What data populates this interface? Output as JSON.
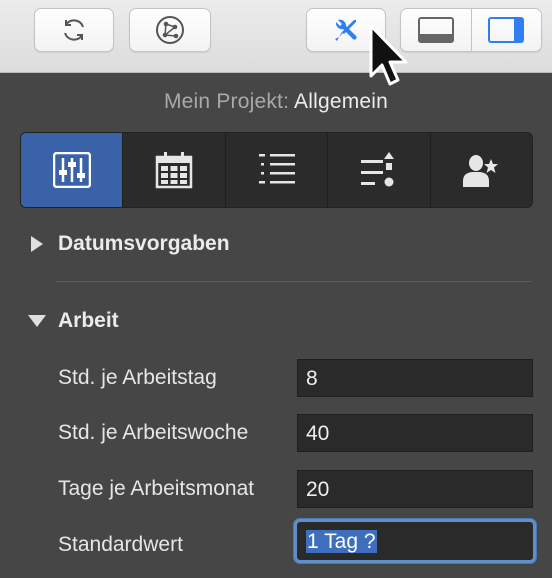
{
  "toolbar": {
    "buttons": [
      {
        "icon": "refresh-icon",
        "interactable": true
      },
      {
        "icon": "network-icon",
        "interactable": true
      },
      {
        "icon": "tools-icon",
        "interactable": true
      }
    ],
    "view_toggle": [
      {
        "icon": "bottom-panel-icon"
      },
      {
        "icon": "right-sidebar-icon"
      }
    ],
    "accent_color": "#2f7ff2"
  },
  "breadcrumb": {
    "label": "Mein Projekt:",
    "value": "Allgemein"
  },
  "tabs": [
    {
      "icon": "sliders-icon",
      "active": true
    },
    {
      "icon": "calendar-icon",
      "active": false
    },
    {
      "icon": "list-icon",
      "active": false
    },
    {
      "icon": "sort-list-icon",
      "active": false
    },
    {
      "icon": "person-star-icon",
      "active": false
    }
  ],
  "sections": {
    "datumsvorgaben": {
      "title": "Datumsvorgaben",
      "expanded": false
    },
    "arbeit": {
      "title": "Arbeit",
      "expanded": true,
      "rows": [
        {
          "label": "Std. je Arbeitstag",
          "value": "8"
        },
        {
          "label": "Std. je Arbeitswoche",
          "value": "40"
        },
        {
          "label": "Tage je Arbeitsmonat",
          "value": "20"
        },
        {
          "label": "Standardwert",
          "value": "1 Tag ?"
        }
      ]
    }
  },
  "colors": {
    "panel_bg": "#464646",
    "active_tab": "#3a62a8",
    "focus_ring": "#5f8fca",
    "selection": "#3f6ebc"
  }
}
